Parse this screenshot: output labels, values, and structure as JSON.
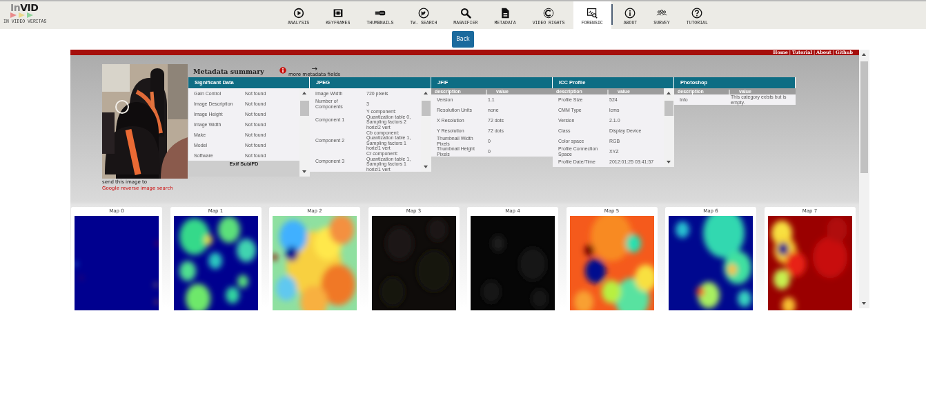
{
  "logo": {
    "title_prefix": "In",
    "title_main": "VID",
    "tagline": "IN VIDEO VERITAS"
  },
  "nav": {
    "main": [
      {
        "label": "ANALYSIS",
        "kind": "play",
        "selected": false
      },
      {
        "label": "KEYFRAMES",
        "kind": "film",
        "selected": false
      },
      {
        "label": "THUMBNAILS",
        "kind": "videologo",
        "selected": false
      },
      {
        "label": "TW. SEARCH",
        "kind": "bird",
        "selected": false
      },
      {
        "label": "MAGNIFIER",
        "kind": "magnifier",
        "selected": false
      },
      {
        "label": "METADATA",
        "kind": "document",
        "selected": false
      },
      {
        "label": "VIDEO RIGHTS",
        "kind": "copyright",
        "selected": false
      },
      {
        "label": "FORENSIC",
        "kind": "forensic",
        "selected": true
      }
    ],
    "secondary": [
      {
        "label": "ABOUT",
        "kind": "info",
        "selected": false
      },
      {
        "label": "SURVEY",
        "kind": "people",
        "selected": false
      },
      {
        "label": "TUTORIAL",
        "kind": "help",
        "selected": false
      }
    ]
  },
  "back_button": "Back",
  "frame": {
    "links": [
      {
        "kind": "link",
        "label": "Home"
      },
      {
        "kind": "separator",
        "label": "|"
      },
      {
        "kind": "link",
        "label": "Tutorial"
      },
      {
        "kind": "separator",
        "label": "|"
      },
      {
        "kind": "link",
        "label": "About"
      },
      {
        "kind": "separator",
        "label": "|"
      },
      {
        "kind": "link",
        "label": "Github"
      }
    ],
    "photo": {
      "kind": "picture",
      "caption": "send this image to",
      "caption_link": "Google reverse image search"
    },
    "summary": {
      "title": "Metadata summary",
      "arrow": "→",
      "more_link": "more metadata fields"
    },
    "panels": [
      {
        "title": "Significant Data",
        "scrollbar": true,
        "footer": "Exif SubIFD",
        "rows": [
          {
            "label": "Gain Control",
            "value": "Not found"
          },
          {
            "label": "Image Description",
            "value": "Not found"
          },
          {
            "label": "Image Height",
            "value": "Not found"
          },
          {
            "label": "Image Width",
            "value": "Not found"
          },
          {
            "label": "Make",
            "value": "Not found"
          },
          {
            "label": "Model",
            "value": "Not found"
          },
          {
            "label": "Software",
            "value": "Not found"
          }
        ]
      },
      {
        "title": "JPEG",
        "scrollbar": true,
        "rows": [
          {
            "label": "Image Width",
            "value": "720 pixels"
          },
          {
            "label": "Number of Components",
            "value": "3"
          },
          {
            "label": "Component 1",
            "value": "Y component: Quantization table 0, Sampling factors 2 horiz/2 vert"
          },
          {
            "label": "Component 2",
            "value": "Cb component: Quantization table 1, Sampling factors 1 horiz/1 vert"
          },
          {
            "label": "Component 3",
            "value": "Cr component: Quantization table 1, Sampling factors 1 horiz/1 vert"
          }
        ]
      },
      {
        "title": "JFIF",
        "columns": [
          "description",
          "|",
          "value"
        ],
        "rows": [
          {
            "label": "Version",
            "value": "1.1"
          },
          {
            "label": "Resolution Units",
            "value": "none"
          },
          {
            "label": "X Resolution",
            "value": "72 dots"
          },
          {
            "label": "Y Resolution",
            "value": "72 dots"
          },
          {
            "label": "Thumbnail Width Pixels",
            "value": "0"
          },
          {
            "label": "Thumbnail Height Pixels",
            "value": "0"
          }
        ]
      },
      {
        "title": "ICC Profile",
        "scrollbar": true,
        "columns": [
          "description",
          "|",
          "value"
        ],
        "rows": [
          {
            "label": "Profile Size",
            "value": "524"
          },
          {
            "label": "CMM Type",
            "value": "lcms"
          },
          {
            "label": "Version",
            "value": "2.1.0"
          },
          {
            "label": "Class",
            "value": "Display Device"
          },
          {
            "label": "Color space",
            "value": "RGB"
          },
          {
            "label": "Profile Connection Space",
            "value": "XYZ"
          },
          {
            "label": "Profile Date/Time",
            "value": "2012:01:25 03:41:57"
          }
        ]
      },
      {
        "title": "Photoshop",
        "columns": [
          "description",
          "|",
          "value"
        ],
        "rows": [
          {
            "label": "Info",
            "value": "This category exists but is empty."
          }
        ]
      }
    ],
    "maps": [
      {
        "title": "Map 0",
        "kind": "picture"
      },
      {
        "title": "Map 1",
        "kind": "picture"
      },
      {
        "title": "Map 2",
        "kind": "picture"
      },
      {
        "title": "Map 3",
        "kind": "picture"
      },
      {
        "title": "Map 4",
        "kind": "picture"
      },
      {
        "title": "Map 5",
        "kind": "picture"
      },
      {
        "title": "Map 6",
        "kind": "picture"
      },
      {
        "title": "Map 7",
        "kind": "picture"
      }
    ]
  }
}
